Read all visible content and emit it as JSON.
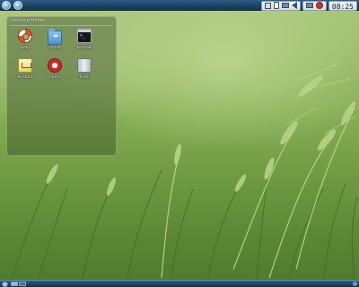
{
  "desktop": {
    "wallpaper": "wheat-field",
    "folder_view": {
      "title": "Desktop Folder",
      "icons": [
        {
          "label": "Help",
          "icon": "help-lifebuoy-icon"
        },
        {
          "label": "Home",
          "icon": "home-folder-icon"
        },
        {
          "label": "Konsole",
          "icon": "konsole-terminal-icon"
        },
        {
          "label": "Kontact",
          "icon": "kontact-icon"
        },
        {
          "label": "Opera",
          "icon": "opera-icon"
        },
        {
          "label": "Trash",
          "icon": "trash-icon"
        }
      ]
    }
  },
  "top_panel": {
    "launchers": [
      "kde-launcher-icon",
      "kde-launcher-icon"
    ],
    "tray_icons": [
      "screen-icon",
      "clipboard-icon",
      "display-icon",
      "volume-icon",
      "network-icon",
      "update-icon"
    ],
    "clock": "08:25"
  },
  "bottom_panel": {
    "desktops": 2,
    "active_desktop": 1
  },
  "colors": {
    "panel": "#1d4466",
    "wallpaper_base": "#86ad55"
  }
}
